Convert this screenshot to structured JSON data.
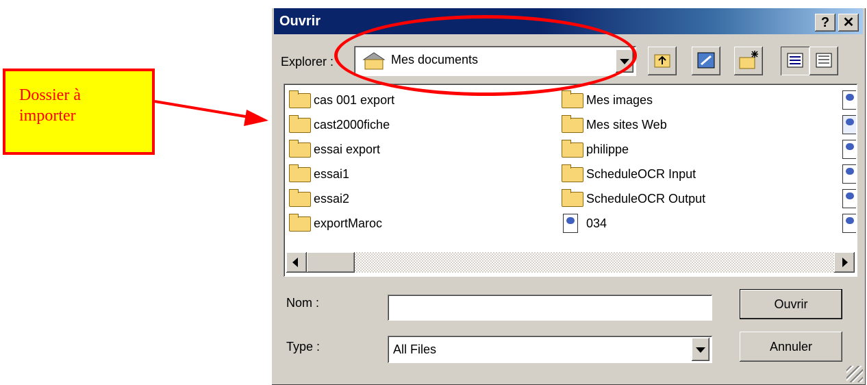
{
  "dialog": {
    "title": "Ouvrir",
    "help_label": "?",
    "close_label": "✕",
    "lookin_label": "Explorer :",
    "lookin_value": "Mes documents",
    "name_label": "Nom :",
    "name_value": "",
    "type_label": "Type :",
    "type_value": "All Files",
    "open_label": "Ouvrir",
    "cancel_label": "Annuler"
  },
  "files": {
    "col1": [
      {
        "name": "cas 001 export",
        "icon": "folder-icon"
      },
      {
        "name": "cast2000fiche",
        "icon": "folder-icon"
      },
      {
        "name": "essai export",
        "icon": "folder-icon"
      },
      {
        "name": "essai1",
        "icon": "folder-icon"
      },
      {
        "name": "essai2",
        "icon": "folder-icon"
      },
      {
        "name": "exportMaroc",
        "icon": "folder-icon"
      }
    ],
    "col2": [
      {
        "name": "Mes images",
        "icon": "folder-icon"
      },
      {
        "name": "Mes sites Web",
        "icon": "folder-icon"
      },
      {
        "name": "philippe",
        "icon": "folder-icon"
      },
      {
        "name": "ScheduleOCR Input",
        "icon": "folder-icon"
      },
      {
        "name": "ScheduleOCR Output",
        "icon": "folder-icon"
      },
      {
        "name": "034",
        "icon": "document-icon"
      }
    ]
  },
  "annotation": {
    "callout_text": "Dossier à\nimporter",
    "color": "#ff0000",
    "fill": "#ffff00"
  }
}
